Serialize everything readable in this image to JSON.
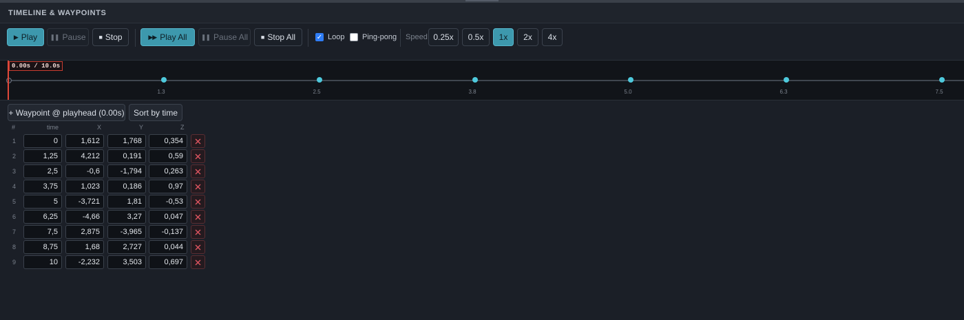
{
  "panel": {
    "title": "TIMELINE & WAYPOINTS"
  },
  "toolbar": {
    "play": "Play",
    "pause": "Pause",
    "stop": "Stop",
    "play_all": "Play All",
    "pause_all": "Pause All",
    "stop_all": "Stop All",
    "loop_label": "Loop",
    "loop_checked": true,
    "pingpong_label": "Ping-pong",
    "pingpong_checked": false,
    "speed_label": "Speed",
    "speeds": [
      "0.25x",
      "0.5x",
      "1x",
      "2x",
      "4x"
    ],
    "active_speed": "1x"
  },
  "timeline": {
    "playhead_label": "0.00s / 10.0s",
    "current_time": 0,
    "duration": 10,
    "ticks": [
      "1.3",
      "2.5",
      "3.8",
      "5.0",
      "6.3",
      "7.5"
    ],
    "accent_color": "#4ec9dc",
    "playhead_color": "#e0483a"
  },
  "actions": {
    "add_waypoint": "+ Waypoint @ playhead (0.00s)",
    "sort": "Sort by time"
  },
  "table": {
    "headers": [
      "#",
      "time",
      "X",
      "Y",
      "Z"
    ],
    "rows": [
      [
        "1",
        "0",
        "1,612",
        "1,768",
        "0,354"
      ],
      [
        "2",
        "1,25",
        "4,212",
        "0,191",
        "0,59"
      ],
      [
        "3",
        "2,5",
        "-0,6",
        "-1,794",
        "0,263"
      ],
      [
        "4",
        "3,75",
        "1,023",
        "0,186",
        "0,97"
      ],
      [
        "5",
        "5",
        "-3,721",
        "1,81",
        "-0,53"
      ],
      [
        "6",
        "6,25",
        "-4,66",
        "3,27",
        "0,047"
      ],
      [
        "7",
        "7,5",
        "2,875",
        "-3,965",
        "-0,137"
      ],
      [
        "8",
        "8,75",
        "1,68",
        "2,727",
        "0,044"
      ],
      [
        "9",
        "10",
        "-2,232",
        "3,503",
        "0,697"
      ]
    ],
    "delete_icon": "close-icon"
  }
}
